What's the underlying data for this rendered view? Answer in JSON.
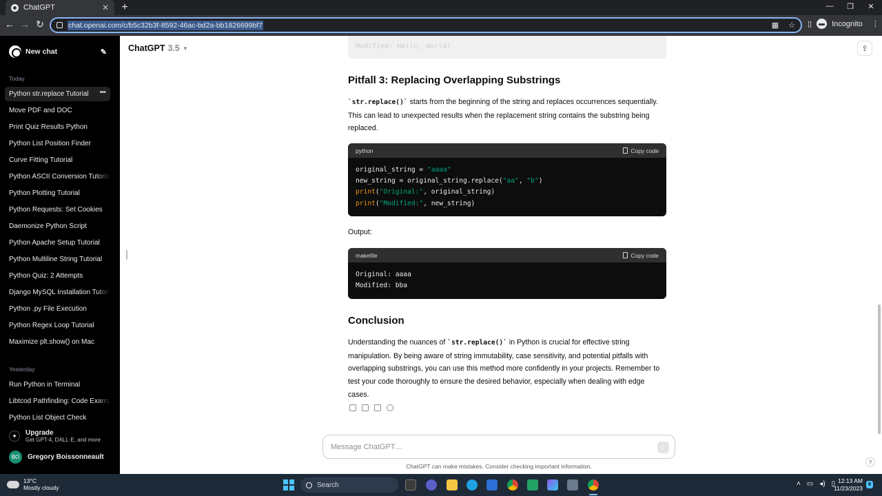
{
  "browser": {
    "tab_title": "ChatGPT",
    "url": "chat.openai.com/c/b5c32b3f-8592-46ac-bd2a-bb1826699bf7",
    "incognito_label": "Incognito"
  },
  "sidebar": {
    "new_chat": "New chat",
    "sections": [
      {
        "label": "Today",
        "items": [
          "Python str.replace Tutorial",
          "Move PDF and DOC",
          "Print Quiz Results Python",
          "Python List Position Finder",
          "Curve Fitting Tutorial",
          "Python ASCII Conversion Tutorial",
          "Python Plotting Tutorial",
          "Python Requests: Set Cookies",
          "Daemonize Python Script",
          "Python Apache Setup Tutorial",
          "Python Multiline String Tutorial",
          "Python Quiz: 2 Attempts",
          "Django MySQL Installation Tutorial",
          "Python .py File Execution",
          "Python Regex Loop Tutorial",
          "Maximize plt.show() on Mac"
        ]
      },
      {
        "label": "Yesterday",
        "items": [
          "Run Python in Terminal",
          "Libtcod Pathfinding: Code Example",
          "Python List Object Check"
        ]
      }
    ],
    "upgrade_title": "Upgrade",
    "upgrade_subtitle": "Get GPT-4, DALL·E, and more",
    "user_initials": "BO",
    "user_name": "Gregory Boissonneault"
  },
  "header": {
    "model_name": "ChatGPT",
    "model_version": "3.5"
  },
  "content": {
    "prev_code_line": "Modified: Hello, World!",
    "pitfall_heading": "Pitfall 3: Replacing Overlapping Substrings",
    "pitfall_code": "`str.replace()`",
    "pitfall_line1": " starts from the beginning of the string and replaces occurrences sequentially.",
    "pitfall_rest": "This can lead to unexpected results when the replacement string contains the substring being replaced.",
    "code1": {
      "lang": "python",
      "copy_label": "Copy code",
      "l1_var": "original_string = ",
      "l1_str": "\"aaaa\"",
      "l2_a": "new_string = original_string.replace(",
      "l2_s1": "\"aa\"",
      "l2_c": ", ",
      "l2_s2": "\"b\"",
      "l2_e": ")",
      "l3_kw": "print",
      "l3_a": "(",
      "l3_str": "\"Original:\"",
      "l3_rest": ", original_string)",
      "l4_kw": "print",
      "l4_a": "(",
      "l4_str": "\"Modified:\"",
      "l4_rest": ", new_string)"
    },
    "output_label": "Output:",
    "code2": {
      "lang": "makefile",
      "copy_label": "Copy code",
      "text": "Original: aaaa\nModified: bba"
    },
    "conclusion_heading": "Conclusion",
    "conclusion_pre": "Understanding the nuances of ",
    "conclusion_code": "`str.replace()`",
    "conclusion_post": " in Python is crucial for effective string manipulation. By being aware of string immutability, case sensitivity, and potential pitfalls with overlapping substrings, you can use this method more confidently in your projects. Remember to test your code thoroughly to ensure the desired behavior, especially when dealing with edge cases."
  },
  "composer": {
    "placeholder": "Message ChatGPT…",
    "disclaimer": "ChatGPT can make mistakes. Consider checking important information.",
    "help": "?"
  },
  "taskbar": {
    "temperature": "13°C",
    "weather": "Mostly cloudy",
    "search_label": "Search",
    "time": "12:13 AM",
    "date": "11/23/2023",
    "notifications": "9"
  }
}
